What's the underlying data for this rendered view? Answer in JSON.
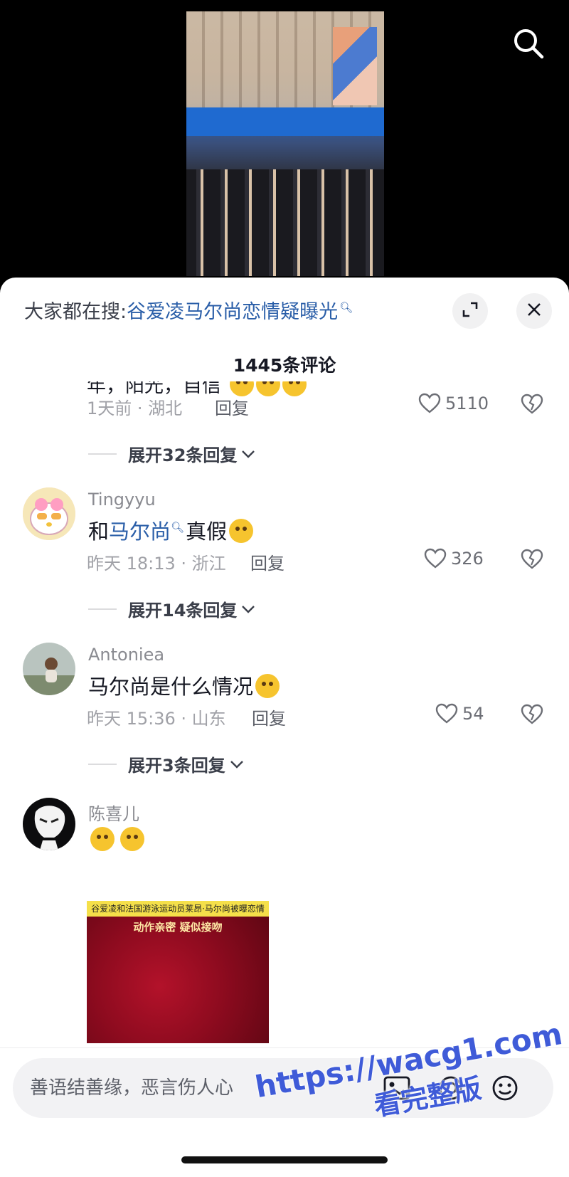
{
  "hot_search": {
    "prefix": "大家都在搜:",
    "query": "谷爱凌马尔尚恋情疑曝光"
  },
  "comment_count": "1445条评论",
  "partial_comment": {
    "text": "年，阳光，自信",
    "time_location": "1天前 · 湖北",
    "reply_label": "回复",
    "likes": "5110",
    "expand_label": "展开32条回复"
  },
  "comments": [
    {
      "username": "Tingyyu",
      "text_before": "和",
      "text_link": "马尔尚",
      "text_after": "真假",
      "time_location": "昨天 18:13 · 浙江",
      "reply_label": "回复",
      "likes": "326",
      "expand_label": "展开14条回复"
    },
    {
      "username": "Antoniea",
      "text": "马尔尚是什么情况",
      "time_location": "昨天 15:36 · 山东",
      "reply_label": "回复",
      "likes": "54",
      "expand_label": "展开3条回复"
    },
    {
      "username": "陈喜儿",
      "image_caption_top": "谷爱凌和法国游泳运动员莱昂·马尔尚被曝恋情",
      "image_caption_main": "动作亲密 疑似接吻"
    }
  ],
  "input": {
    "placeholder": "善语结善缘，恶言伤人心"
  },
  "icons": {
    "search": "search-icon",
    "expand": "expand-icon",
    "close": "close-icon",
    "like": "heart-icon",
    "dislike": "broken-heart-icon",
    "image": "image-icon",
    "mention": "at-icon",
    "emoji": "emoji-icon"
  },
  "watermark": {
    "url": "https://wacg1.com",
    "tag": "看完整版"
  },
  "colors": {
    "link": "#2a5ea8",
    "watermark": "#3f5bd8",
    "meta": "#a0a1a7"
  }
}
